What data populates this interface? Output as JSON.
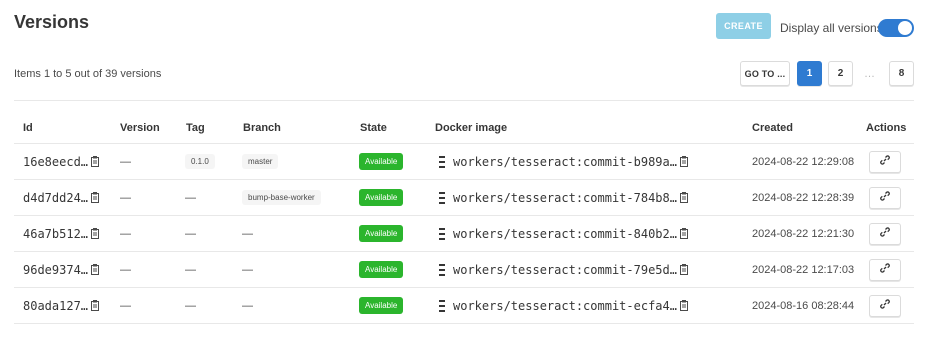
{
  "page": {
    "title": "Versions",
    "create_label": "CREATE",
    "display_all_label": "Display all versions",
    "display_all_on": true,
    "items_count": "Items 1 to 5 out of 39 versions"
  },
  "pagination": {
    "goto_label": "GO TO ...",
    "pages": [
      "1",
      "2",
      "8"
    ],
    "current": "1",
    "ellipsis": "…"
  },
  "table": {
    "columns": [
      "Id",
      "Version",
      "Tag",
      "Branch",
      "State",
      "Docker image",
      "Created",
      "Actions"
    ],
    "rows": [
      {
        "id": "16e8eecd…",
        "version": "—",
        "tag": "0.1.0",
        "branch": "master",
        "state": "Available",
        "docker": "workers/tesseract:commit-b989a…",
        "created": "2024-08-22 12:29:08"
      },
      {
        "id": "d4d7dd24…",
        "version": "—",
        "tag": "—",
        "branch": "bump-base-worker",
        "state": "Available",
        "docker": "workers/tesseract:commit-784b8…",
        "created": "2024-08-22 12:28:39"
      },
      {
        "id": "46a7b512…",
        "version": "—",
        "tag": "—",
        "branch": "—",
        "state": "Available",
        "docker": "workers/tesseract:commit-840b2…",
        "created": "2024-08-22 12:21:30"
      },
      {
        "id": "96de9374…",
        "version": "—",
        "tag": "—",
        "branch": "—",
        "state": "Available",
        "docker": "workers/tesseract:commit-79e5d…",
        "created": "2024-08-22 12:17:03"
      },
      {
        "id": "80ada127…",
        "version": "—",
        "tag": "—",
        "branch": "—",
        "state": "Available",
        "docker": "workers/tesseract:commit-ecfa4…",
        "created": "2024-08-16 08:28:44"
      }
    ]
  },
  "icons": {
    "copy": "clipboard-icon",
    "drag": "drag-handle-icon",
    "action": "link-icon"
  },
  "colors": {
    "accent": "#2f7bd1",
    "create_button": "#8ecfe6",
    "state_available": "#2bb52d"
  }
}
